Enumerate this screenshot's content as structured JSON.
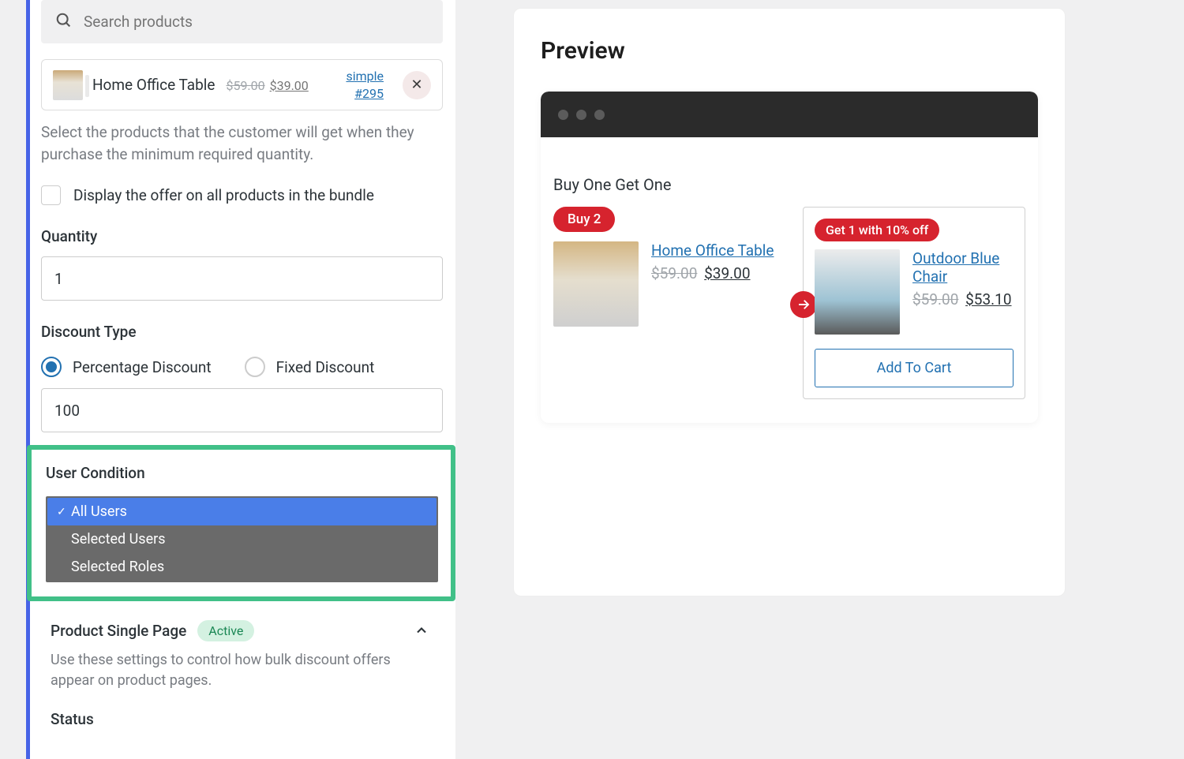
{
  "search": {
    "placeholder": "Search products"
  },
  "product": {
    "title": "Home Office Table",
    "old_price": "$59.00",
    "new_price": "$39.00",
    "type": "simple",
    "id_label": "#295"
  },
  "help": "Select the products that the customer will get when they purchase the minimum required quantity.",
  "checkbox": {
    "label": "Display the offer on all products in the bundle"
  },
  "quantity": {
    "label": "Quantity",
    "value": "1"
  },
  "discount": {
    "label": "Discount Type",
    "percentage": "Percentage Discount",
    "fixed": "Fixed Discount",
    "value": "100"
  },
  "user_condition": {
    "label": "User Condition",
    "options": [
      "All Users",
      "Selected Users",
      "Selected Roles"
    ]
  },
  "product_single": {
    "title": "Product Single Page",
    "badge": "Active",
    "desc": "Use these settings to control how bulk discount offers appear on product pages.",
    "status": "Status"
  },
  "preview": {
    "title": "Preview",
    "bogo": "Buy One Get One",
    "buy_tag": "Buy 2",
    "get_tag": "Get 1 with 10% off",
    "left": {
      "name": "Home Office Table",
      "old": "$59.00",
      "new": "$39.00"
    },
    "right": {
      "name": "Outdoor Blue Chair",
      "old": "$59.00",
      "new": "$53.10"
    },
    "add_cart": "Add To Cart"
  }
}
